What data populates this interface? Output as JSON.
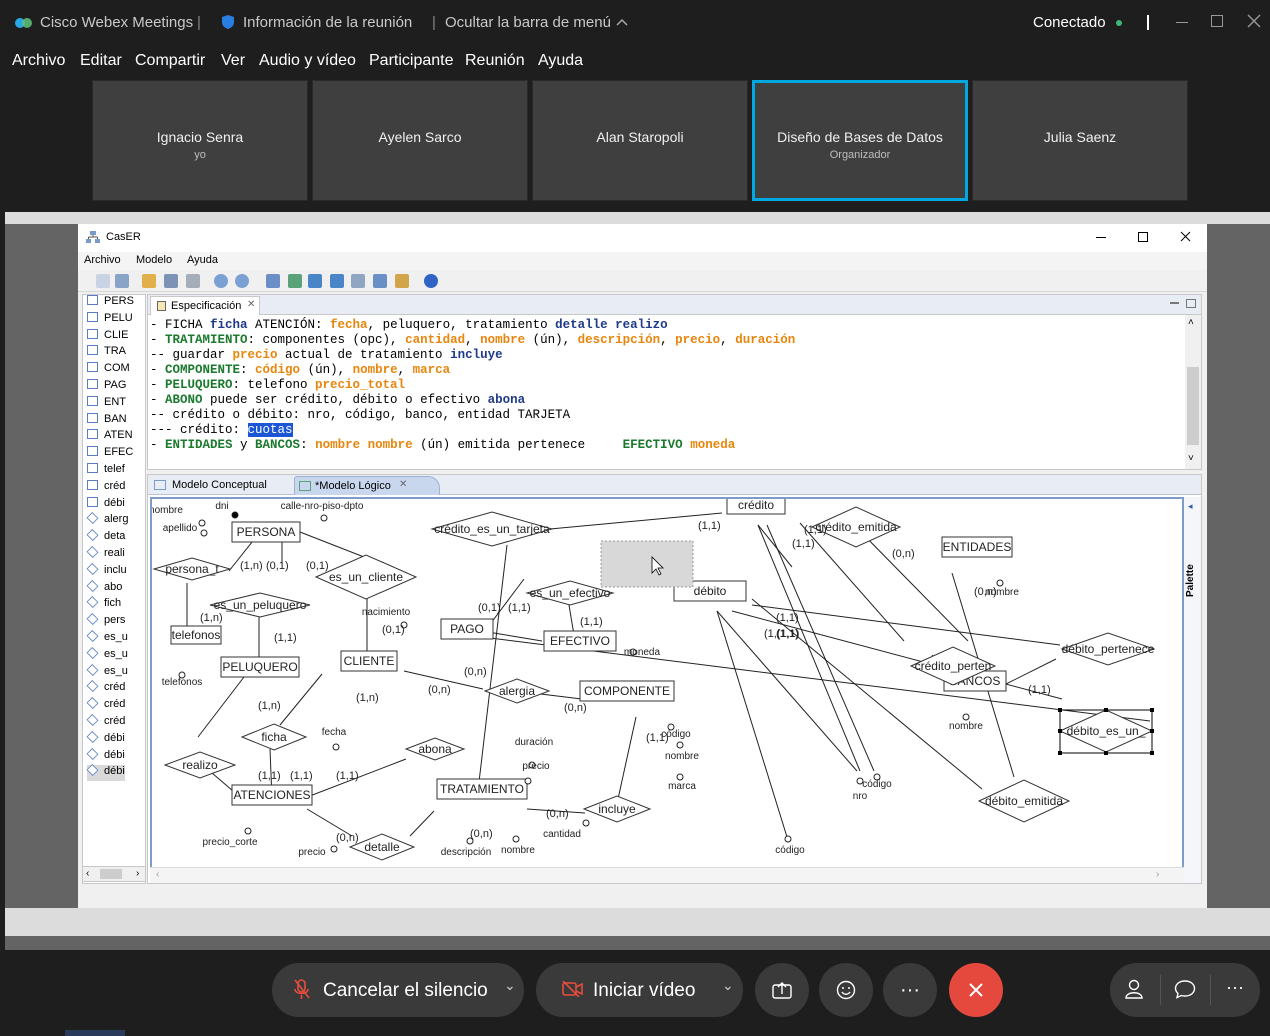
{
  "titlebar": {
    "app": "Cisco Webex Meetings",
    "info": "Información de la reunión",
    "hide": "Ocultar la barra de menú",
    "status": "Conectado"
  },
  "menu": [
    "Archivo",
    "Editar",
    "Compartir",
    "Ver",
    "Audio y vídeo",
    "Participante",
    "Reunión",
    "Ayuda"
  ],
  "participants": [
    {
      "name": "Ignacio Senra",
      "sub": "yo"
    },
    {
      "name": "Ayelen Sarco",
      "sub": ""
    },
    {
      "name": "Alan Staropoli",
      "sub": ""
    },
    {
      "name": "Diseño de Bases de Datos",
      "sub": "Organizador"
    },
    {
      "name": "Julia Saenz",
      "sub": ""
    }
  ],
  "caser": {
    "title": "CasER",
    "menu": [
      "Archivo",
      "Modelo",
      "Ayuda"
    ],
    "tree": [
      "PERS",
      "PELU",
      "CLIE",
      "TRA",
      "COM",
      "PAG",
      "ENT",
      "BAN",
      "ATEN",
      "EFEC",
      "telef",
      "créd",
      "débi",
      "alerg",
      "deta",
      "reali",
      "inclu",
      "abo",
      "fich",
      "pers",
      "es_u",
      "es_u",
      "es_u",
      "créd",
      "créd",
      "créd",
      "débi",
      "débi",
      "débi"
    ],
    "spec_tab": "Especificación",
    "spec_lines": [
      [
        [
          "- FICHA ",
          ""
        ],
        [
          "ficha",
          "b"
        ],
        [
          " ATENCIÓN: ",
          ""
        ],
        [
          "fecha",
          "o"
        ],
        [
          ", peluquero, tratamiento ",
          ""
        ],
        [
          "detalle realizo",
          "b"
        ]
      ],
      [
        [
          "- ",
          ""
        ],
        [
          "TRATAMIENTO",
          "g"
        ],
        [
          ": componentes (opc), ",
          ""
        ],
        [
          "cantidad",
          "o"
        ],
        [
          ", ",
          ""
        ],
        [
          "nombre",
          "o"
        ],
        [
          " (ún), ",
          ""
        ],
        [
          "descripción",
          "o"
        ],
        [
          ", ",
          ""
        ],
        [
          "precio",
          "o"
        ],
        [
          ", ",
          ""
        ],
        [
          "duración",
          "o"
        ]
      ],
      [
        [
          "-- guardar ",
          ""
        ],
        [
          "precio",
          "o"
        ],
        [
          " actual de tratamiento ",
          ""
        ],
        [
          "incluye",
          "b"
        ]
      ],
      [
        [
          "- ",
          ""
        ],
        [
          "COMPONENTE",
          "g"
        ],
        [
          ": ",
          ""
        ],
        [
          "código",
          "o"
        ],
        [
          " (ún), ",
          ""
        ],
        [
          "nombre",
          "o"
        ],
        [
          ", ",
          ""
        ],
        [
          "marca",
          "o"
        ]
      ],
      [
        [
          "- ",
          ""
        ],
        [
          "PELUQUERO",
          "g"
        ],
        [
          ": telefono ",
          ""
        ],
        [
          "precio_total",
          "o"
        ]
      ],
      [
        [
          "- ",
          ""
        ],
        [
          "ABONO",
          "g"
        ],
        [
          " puede ser crédito, débito o efectivo ",
          ""
        ],
        [
          "abona",
          "b"
        ]
      ],
      [
        [
          "-- crédito o débito: nro, código, banco, entidad TARJETA",
          ""
        ]
      ],
      [
        [
          "--- crédito: ",
          ""
        ],
        [
          "cuotas",
          "sel"
        ]
      ],
      [
        [
          "- ",
          ""
        ],
        [
          "ENTIDADES",
          "g"
        ],
        [
          " y ",
          ""
        ],
        [
          "BANCOS",
          "g"
        ],
        [
          ": ",
          ""
        ],
        [
          "nombre nombre",
          "o"
        ],
        [
          " (ún) emitida pertenece     ",
          ""
        ],
        [
          "EFECTIVO",
          "g"
        ],
        [
          " ",
          ""
        ],
        [
          "moneda",
          "o"
        ]
      ]
    ],
    "diagram_tabs": [
      "Modelo Conceptual",
      "*Modelo Lógico"
    ],
    "palette": "Palette"
  },
  "diagram": {
    "entities": [
      "PERSONA",
      "PELUQUERO",
      "CLIENTE",
      "PAGO",
      "EFECTIVO",
      "COMPONENTE",
      "TRATAMIENTO",
      "ATENCIONES",
      "ENTIDADES",
      "BANCOS",
      "crédito",
      "débito",
      "telefonos"
    ],
    "relations": [
      "persona_t",
      "es_un_peluquero",
      "es_un_cliente",
      "crédito_es_un_tarjeta",
      "es_un_efectivo",
      "crédito_emitida",
      "alergia",
      "ficha",
      "realizo",
      "abona",
      "detalle",
      "incluye",
      "crédito_perten",
      "débito_pertenece",
      "débito_es_un_",
      "débito_emitida"
    ],
    "attributes": [
      "nombre",
      "dni",
      "apellido",
      "calle-nro-piso-dpto",
      "telefonos",
      "nacimiento",
      "moneda",
      "código",
      "nombre",
      "marca",
      "duración",
      "precio",
      "cantidad",
      "descripción",
      "nombre",
      "precio_corte",
      "precio",
      "fecha",
      "nombre",
      "nombre",
      "nro",
      "código",
      "código"
    ],
    "cards": [
      "(1,1)",
      "(1,1)",
      "(1,1)",
      "(0,n)",
      "(1,n)",
      "(0,1)",
      "(0,1)",
      "(1,n)",
      "(1,1)",
      "(0,1)",
      "(0,1)",
      "(1,1)",
      "(1,1)",
      "(0,n)",
      "(0,n)",
      "(0,n)",
      "(1,n)",
      "(1,n)",
      "(1,1)",
      "(1,1)",
      "(1,1)",
      "(0,n)",
      "(0,n)",
      "(0,n)",
      "(1,1)",
      "(1,1)",
      "(1,1)",
      "(0,n)",
      "(1,(1,1)",
      "(1,1)"
    ]
  },
  "controls": {
    "mute": "Cancelar el silencio",
    "video": "Iniciar vídeo"
  }
}
